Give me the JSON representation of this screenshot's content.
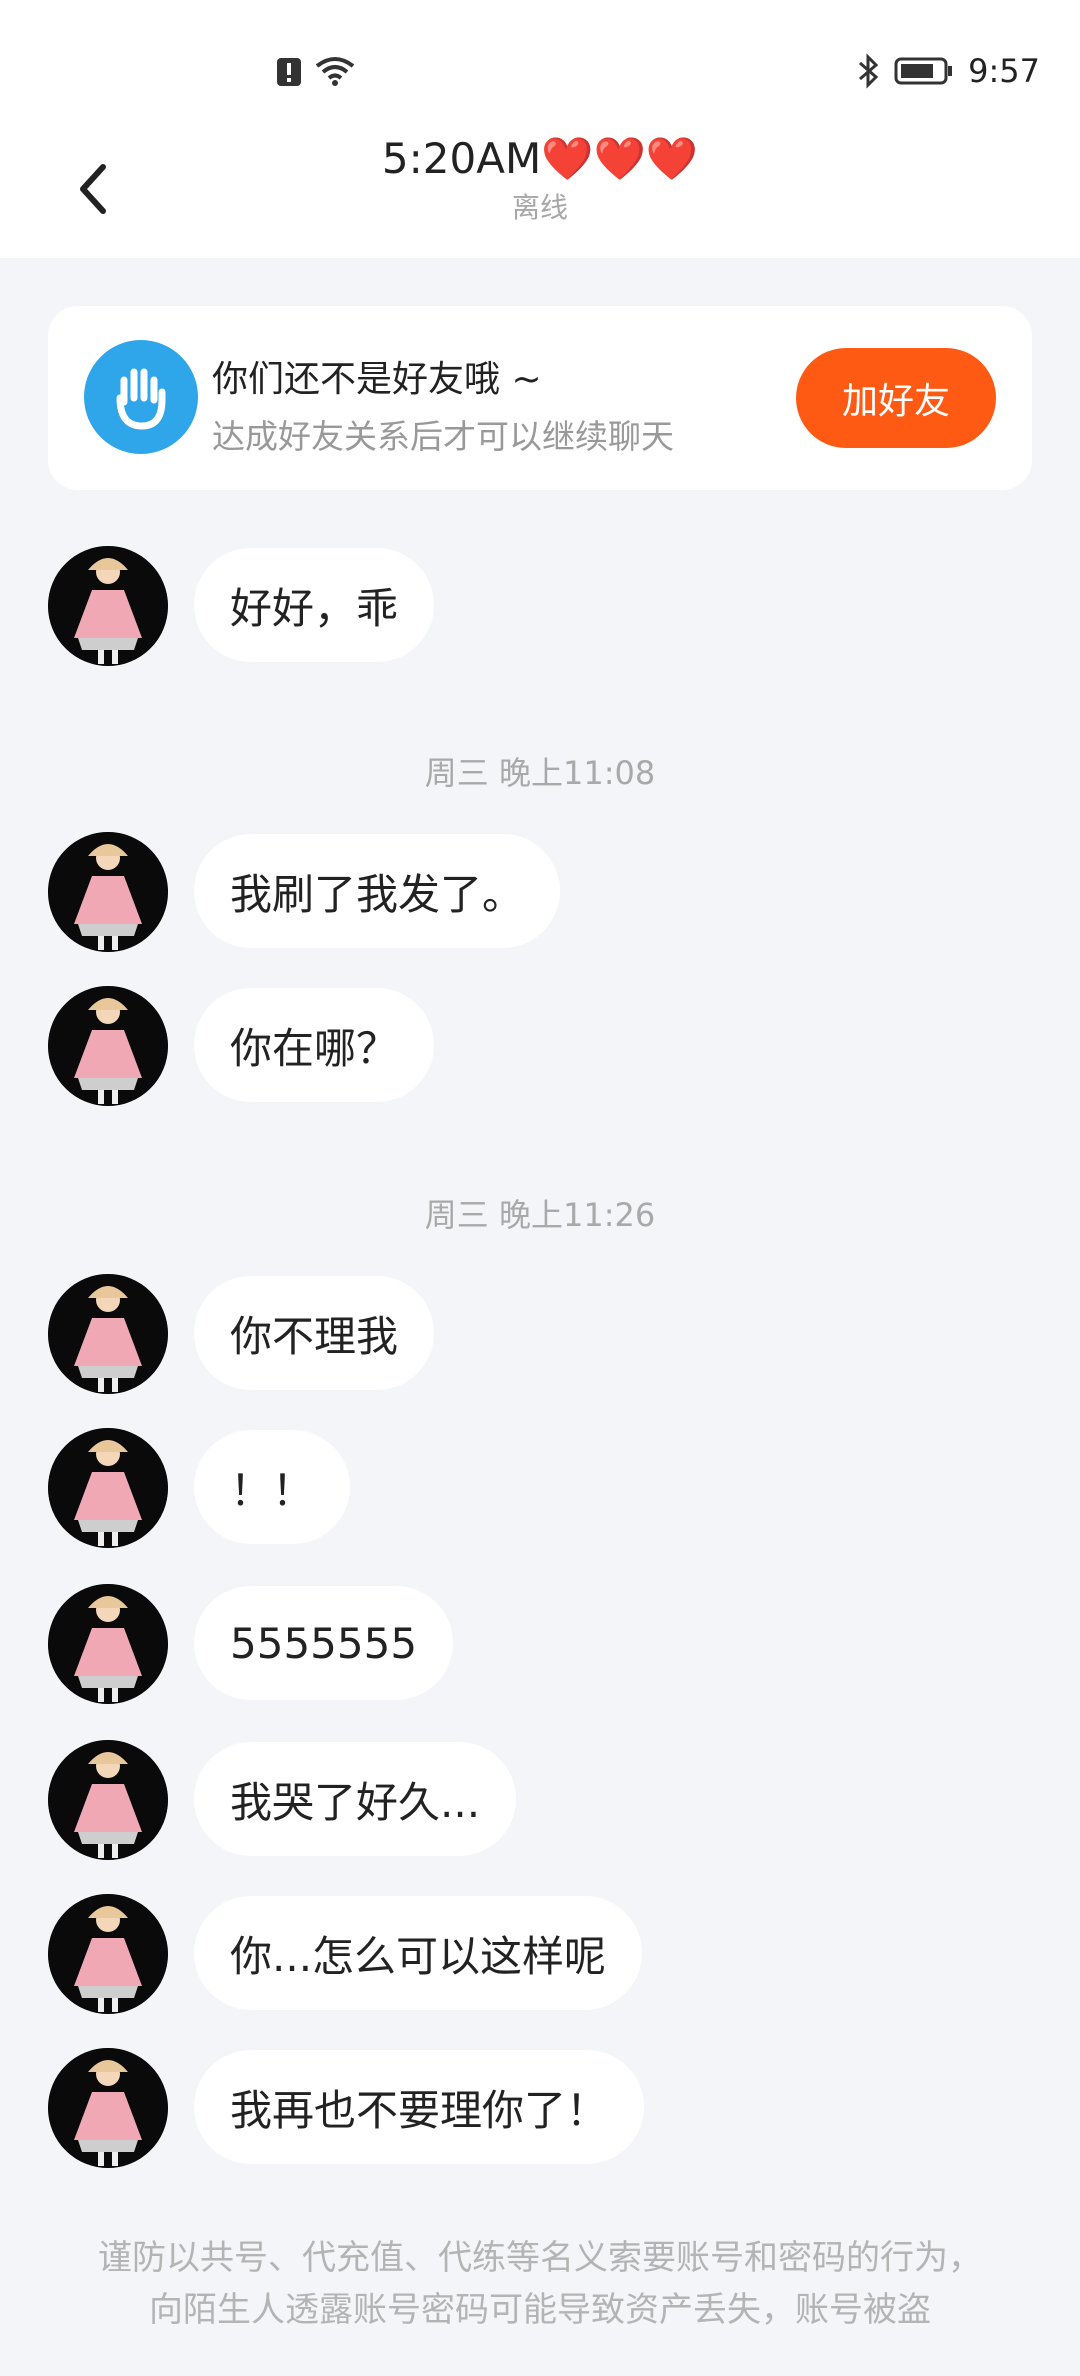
{
  "status_bar": {
    "time": "9:57"
  },
  "header": {
    "title": "5:20AM",
    "hearts": "❤️❤️❤️",
    "status": "离线"
  },
  "friend_card": {
    "title": "你们还不是好友哦 ~",
    "subtitle": "达成好友关系后才可以继续聊天",
    "button": "加好友"
  },
  "messages": [
    {
      "text": "好好，乖"
    },
    {
      "text": "我刷了我发了。"
    },
    {
      "text": "你在哪？"
    },
    {
      "text": "你不理我"
    },
    {
      "text": "！！"
    },
    {
      "text": "5555555"
    },
    {
      "text": "我哭了好久..."
    },
    {
      "text": "你...怎么可以这样呢"
    },
    {
      "text": "我再也不要理你了！"
    }
  ],
  "timestamps": [
    "周三 晚上11:08",
    "周三 晚上11:26"
  ],
  "footer_note": "谨防以共号、代充值、代练等名义索要账号和密码的行为，向陌生人透露账号密码可能导致资产丢失，账号被盗"
}
